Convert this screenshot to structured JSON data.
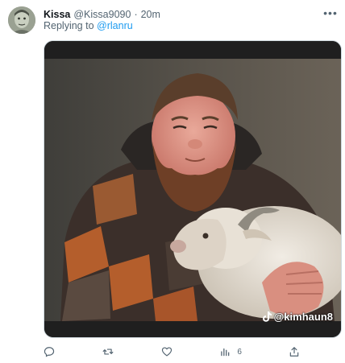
{
  "tweet": {
    "name": "Kissa",
    "handle": "@Kissa9090",
    "separator": "·",
    "time": "20m",
    "replying_prefix": "Replying to",
    "replying_to": "@rlanru",
    "more_label": "•••"
  },
  "media": {
    "watermark": "@kimhaun8",
    "watermark_icon": "tiktok-icon"
  },
  "actions": {
    "reply_icon": "reply-icon",
    "retweet_icon": "retweet-icon",
    "like_icon": "like-icon",
    "views_icon": "views-icon",
    "views_count": "6",
    "share_icon": "share-icon"
  },
  "colors": {
    "accent": "#1d9bf0",
    "secondary_text": "#536471"
  }
}
